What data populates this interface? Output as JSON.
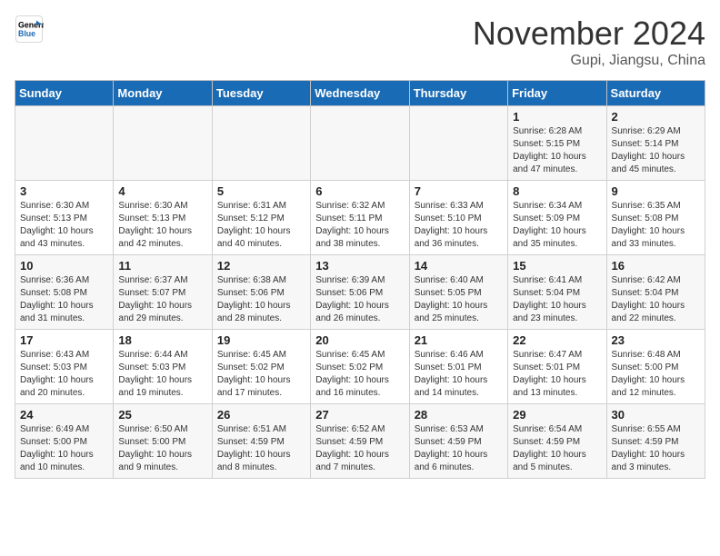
{
  "header": {
    "logo_text_general": "General",
    "logo_text_blue": "Blue",
    "month_title": "November 2024",
    "location": "Gupi, Jiangsu, China"
  },
  "days_of_week": [
    "Sunday",
    "Monday",
    "Tuesday",
    "Wednesday",
    "Thursday",
    "Friday",
    "Saturday"
  ],
  "weeks": [
    [
      {
        "day": "",
        "info": ""
      },
      {
        "day": "",
        "info": ""
      },
      {
        "day": "",
        "info": ""
      },
      {
        "day": "",
        "info": ""
      },
      {
        "day": "",
        "info": ""
      },
      {
        "day": "1",
        "info": "Sunrise: 6:28 AM\nSunset: 5:15 PM\nDaylight: 10 hours\nand 47 minutes."
      },
      {
        "day": "2",
        "info": "Sunrise: 6:29 AM\nSunset: 5:14 PM\nDaylight: 10 hours\nand 45 minutes."
      }
    ],
    [
      {
        "day": "3",
        "info": "Sunrise: 6:30 AM\nSunset: 5:13 PM\nDaylight: 10 hours\nand 43 minutes."
      },
      {
        "day": "4",
        "info": "Sunrise: 6:30 AM\nSunset: 5:13 PM\nDaylight: 10 hours\nand 42 minutes."
      },
      {
        "day": "5",
        "info": "Sunrise: 6:31 AM\nSunset: 5:12 PM\nDaylight: 10 hours\nand 40 minutes."
      },
      {
        "day": "6",
        "info": "Sunrise: 6:32 AM\nSunset: 5:11 PM\nDaylight: 10 hours\nand 38 minutes."
      },
      {
        "day": "7",
        "info": "Sunrise: 6:33 AM\nSunset: 5:10 PM\nDaylight: 10 hours\nand 36 minutes."
      },
      {
        "day": "8",
        "info": "Sunrise: 6:34 AM\nSunset: 5:09 PM\nDaylight: 10 hours\nand 35 minutes."
      },
      {
        "day": "9",
        "info": "Sunrise: 6:35 AM\nSunset: 5:08 PM\nDaylight: 10 hours\nand 33 minutes."
      }
    ],
    [
      {
        "day": "10",
        "info": "Sunrise: 6:36 AM\nSunset: 5:08 PM\nDaylight: 10 hours\nand 31 minutes."
      },
      {
        "day": "11",
        "info": "Sunrise: 6:37 AM\nSunset: 5:07 PM\nDaylight: 10 hours\nand 29 minutes."
      },
      {
        "day": "12",
        "info": "Sunrise: 6:38 AM\nSunset: 5:06 PM\nDaylight: 10 hours\nand 28 minutes."
      },
      {
        "day": "13",
        "info": "Sunrise: 6:39 AM\nSunset: 5:06 PM\nDaylight: 10 hours\nand 26 minutes."
      },
      {
        "day": "14",
        "info": "Sunrise: 6:40 AM\nSunset: 5:05 PM\nDaylight: 10 hours\nand 25 minutes."
      },
      {
        "day": "15",
        "info": "Sunrise: 6:41 AM\nSunset: 5:04 PM\nDaylight: 10 hours\nand 23 minutes."
      },
      {
        "day": "16",
        "info": "Sunrise: 6:42 AM\nSunset: 5:04 PM\nDaylight: 10 hours\nand 22 minutes."
      }
    ],
    [
      {
        "day": "17",
        "info": "Sunrise: 6:43 AM\nSunset: 5:03 PM\nDaylight: 10 hours\nand 20 minutes."
      },
      {
        "day": "18",
        "info": "Sunrise: 6:44 AM\nSunset: 5:03 PM\nDaylight: 10 hours\nand 19 minutes."
      },
      {
        "day": "19",
        "info": "Sunrise: 6:45 AM\nSunset: 5:02 PM\nDaylight: 10 hours\nand 17 minutes."
      },
      {
        "day": "20",
        "info": "Sunrise: 6:45 AM\nSunset: 5:02 PM\nDaylight: 10 hours\nand 16 minutes."
      },
      {
        "day": "21",
        "info": "Sunrise: 6:46 AM\nSunset: 5:01 PM\nDaylight: 10 hours\nand 14 minutes."
      },
      {
        "day": "22",
        "info": "Sunrise: 6:47 AM\nSunset: 5:01 PM\nDaylight: 10 hours\nand 13 minutes."
      },
      {
        "day": "23",
        "info": "Sunrise: 6:48 AM\nSunset: 5:00 PM\nDaylight: 10 hours\nand 12 minutes."
      }
    ],
    [
      {
        "day": "24",
        "info": "Sunrise: 6:49 AM\nSunset: 5:00 PM\nDaylight: 10 hours\nand 10 minutes."
      },
      {
        "day": "25",
        "info": "Sunrise: 6:50 AM\nSunset: 5:00 PM\nDaylight: 10 hours\nand 9 minutes."
      },
      {
        "day": "26",
        "info": "Sunrise: 6:51 AM\nSunset: 4:59 PM\nDaylight: 10 hours\nand 8 minutes."
      },
      {
        "day": "27",
        "info": "Sunrise: 6:52 AM\nSunset: 4:59 PM\nDaylight: 10 hours\nand 7 minutes."
      },
      {
        "day": "28",
        "info": "Sunrise: 6:53 AM\nSunset: 4:59 PM\nDaylight: 10 hours\nand 6 minutes."
      },
      {
        "day": "29",
        "info": "Sunrise: 6:54 AM\nSunset: 4:59 PM\nDaylight: 10 hours\nand 5 minutes."
      },
      {
        "day": "30",
        "info": "Sunrise: 6:55 AM\nSunset: 4:59 PM\nDaylight: 10 hours\nand 3 minutes."
      }
    ]
  ]
}
